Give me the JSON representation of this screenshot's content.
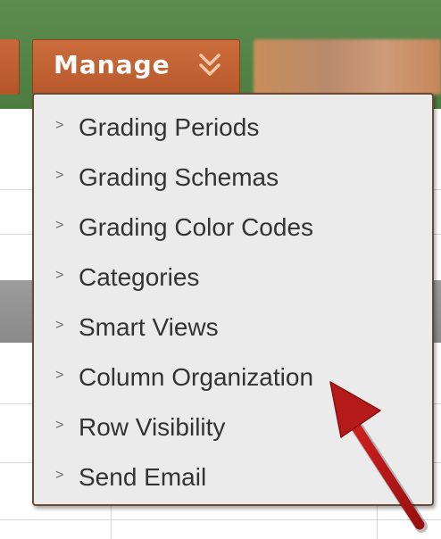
{
  "toolbar": {
    "manage_label": "Manage"
  },
  "menu": {
    "items": [
      {
        "label": "Grading Periods"
      },
      {
        "label": "Grading Schemas"
      },
      {
        "label": "Grading Color Codes"
      },
      {
        "label": "Categories"
      },
      {
        "label": "Smart Views"
      },
      {
        "label": "Column Organization"
      },
      {
        "label": "Row Visibility"
      },
      {
        "label": "Send Email"
      }
    ]
  },
  "colors": {
    "action_bar": "#4c7c40",
    "manage_tab": "#cc6d3c",
    "menu_background": "#ebebeb",
    "arrow": "#b51a1a"
  },
  "icons": {
    "tab_toggle": "double-chevron-down-icon",
    "menu_item_marker": "chevron-right-icon"
  }
}
